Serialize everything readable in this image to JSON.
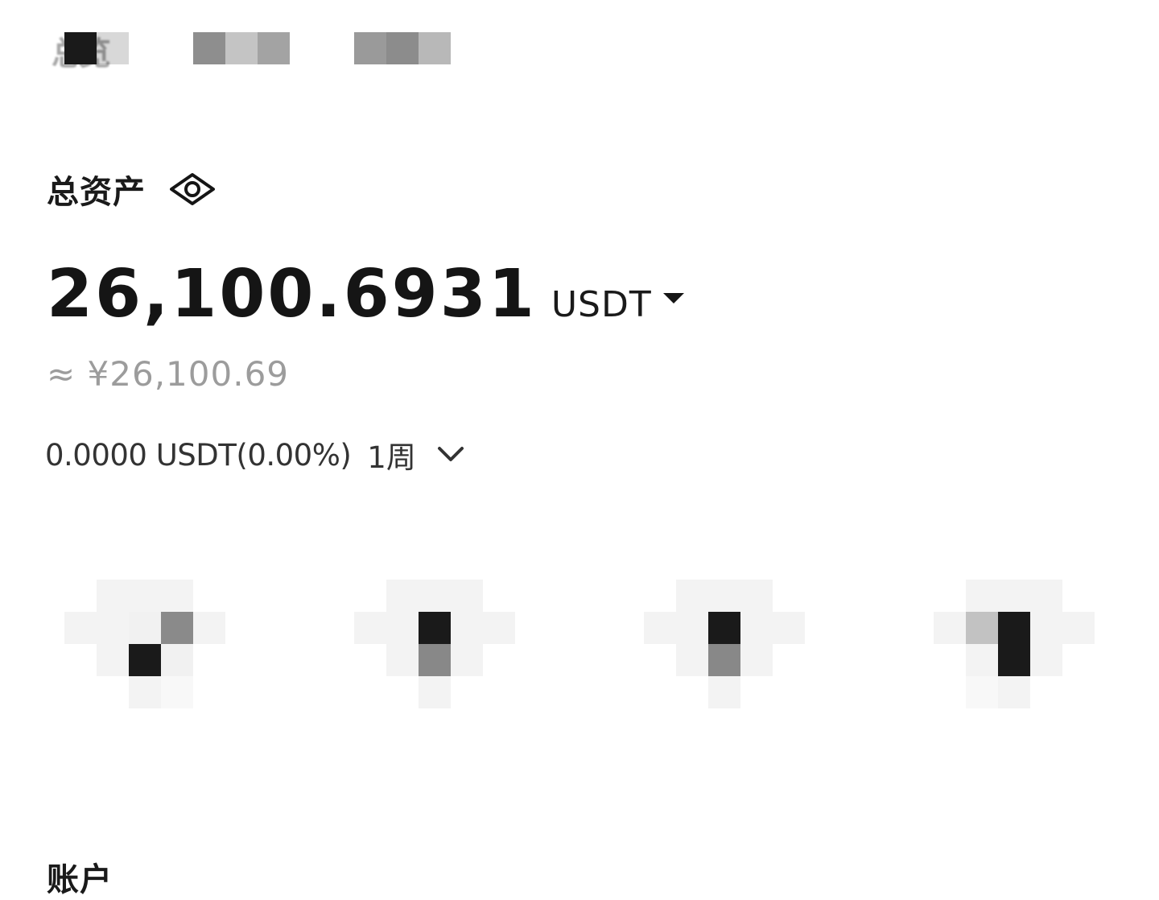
{
  "tabs": [
    {
      "label": "总览",
      "active": true
    },
    {
      "label": "",
      "active": false
    },
    {
      "label": "",
      "active": false
    }
  ],
  "assets": {
    "title": "总资产",
    "visibility_icon": "eye-icon",
    "balance": "26,100.6931",
    "currency": "USDT",
    "fiat_equivalent": "≈ ¥26,100.69",
    "pnl": "0.0000 USDT(0.00%)",
    "period": "1周"
  },
  "actions": [
    {
      "icon": "pixelated-action-icon-1"
    },
    {
      "icon": "pixelated-action-icon-2"
    },
    {
      "icon": "pixelated-action-icon-3"
    },
    {
      "icon": "pixelated-action-icon-4"
    }
  ],
  "accounts": {
    "title": "账户"
  },
  "colors": {
    "background": "#ffffff",
    "text_primary": "#151515",
    "text_secondary": "#9c9c9c",
    "text_muted": "#333333"
  }
}
